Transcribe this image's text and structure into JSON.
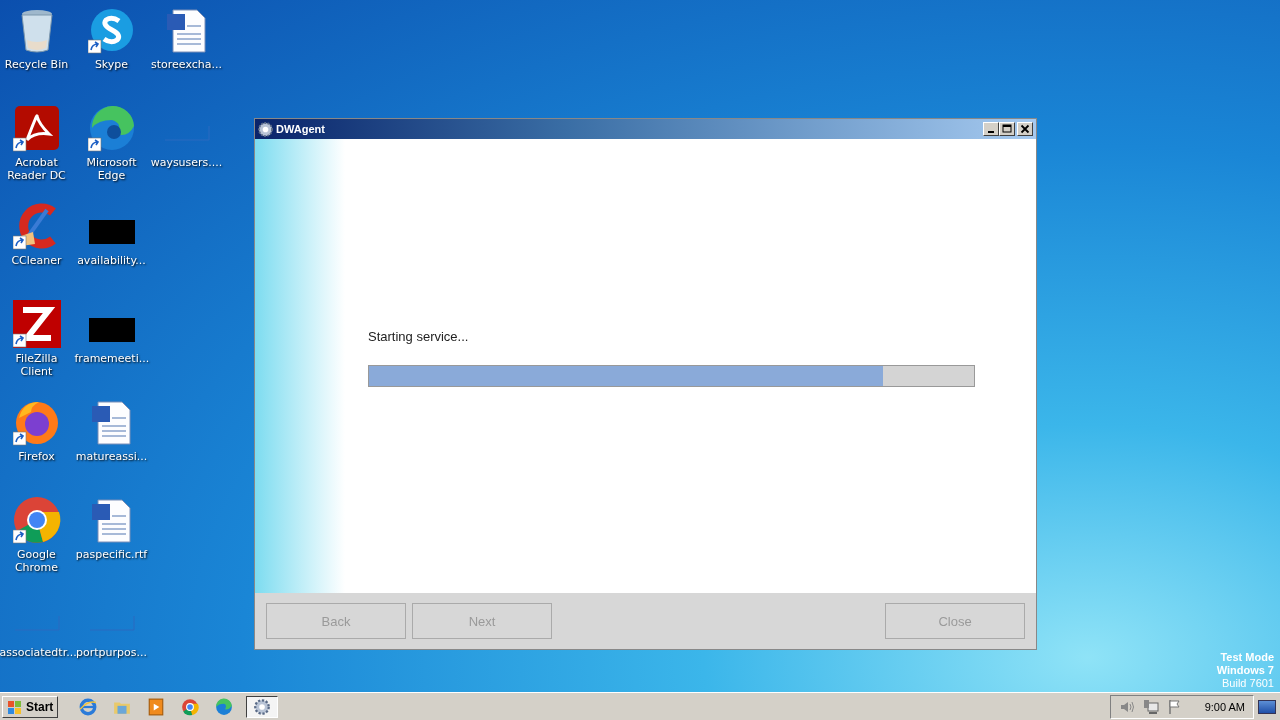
{
  "desktop_icons": [
    {
      "label": "Recycle Bin",
      "kind": "trash",
      "shortcut": false
    },
    {
      "label": "Acrobat Reader DC",
      "kind": "pdf",
      "shortcut": true
    },
    {
      "label": "CCleaner",
      "kind": "cleaner",
      "shortcut": true
    },
    {
      "label": "FileZilla Client",
      "kind": "ftp",
      "shortcut": true
    },
    {
      "label": "Firefox",
      "kind": "firefox",
      "shortcut": true
    },
    {
      "label": "Google Chrome",
      "kind": "chrome",
      "shortcut": true
    },
    {
      "label": "associatedtr...",
      "kind": "blank",
      "shortcut": false
    },
    {
      "label": "Skype",
      "kind": "chat",
      "shortcut": true
    },
    {
      "label": "Microsoft Edge",
      "kind": "edge",
      "shortcut": true
    },
    {
      "label": "availability...",
      "kind": "black",
      "shortcut": false
    },
    {
      "label": "framemeeti...",
      "kind": "black",
      "shortcut": false
    },
    {
      "label": "matureassi...",
      "kind": "doc",
      "shortcut": false
    },
    {
      "label": "paspecific.rtf",
      "kind": "doc",
      "shortcut": false
    },
    {
      "label": "portpurpos...",
      "kind": "blank",
      "shortcut": false
    },
    {
      "label": "storeexcha...",
      "kind": "doc",
      "shortcut": false
    },
    {
      "label": "waysusers....",
      "kind": "blank",
      "shortcut": false
    }
  ],
  "window": {
    "title": "DWAgent",
    "status_text": "Starting service...",
    "progress": {
      "level": 0.85
    },
    "buttons": [
      {
        "label": "Back",
        "disabled": true
      },
      {
        "label": "Next",
        "disabled": true
      },
      {
        "label": "Close",
        "disabled": true
      }
    ]
  },
  "desktop_notice": [
    "Test Mode",
    "Windows 7",
    "Build 7601"
  ],
  "taskbar": {
    "start_label": "Start",
    "apps": [
      {
        "kind": "ie",
        "selected": false
      },
      {
        "kind": "folder",
        "selected": false
      },
      {
        "kind": "media",
        "selected": false
      },
      {
        "kind": "chrome",
        "selected": false
      },
      {
        "kind": "edge",
        "selected": false
      },
      {
        "kind": "gear",
        "selected": true
      }
    ],
    "clock": "9:00 AM"
  }
}
